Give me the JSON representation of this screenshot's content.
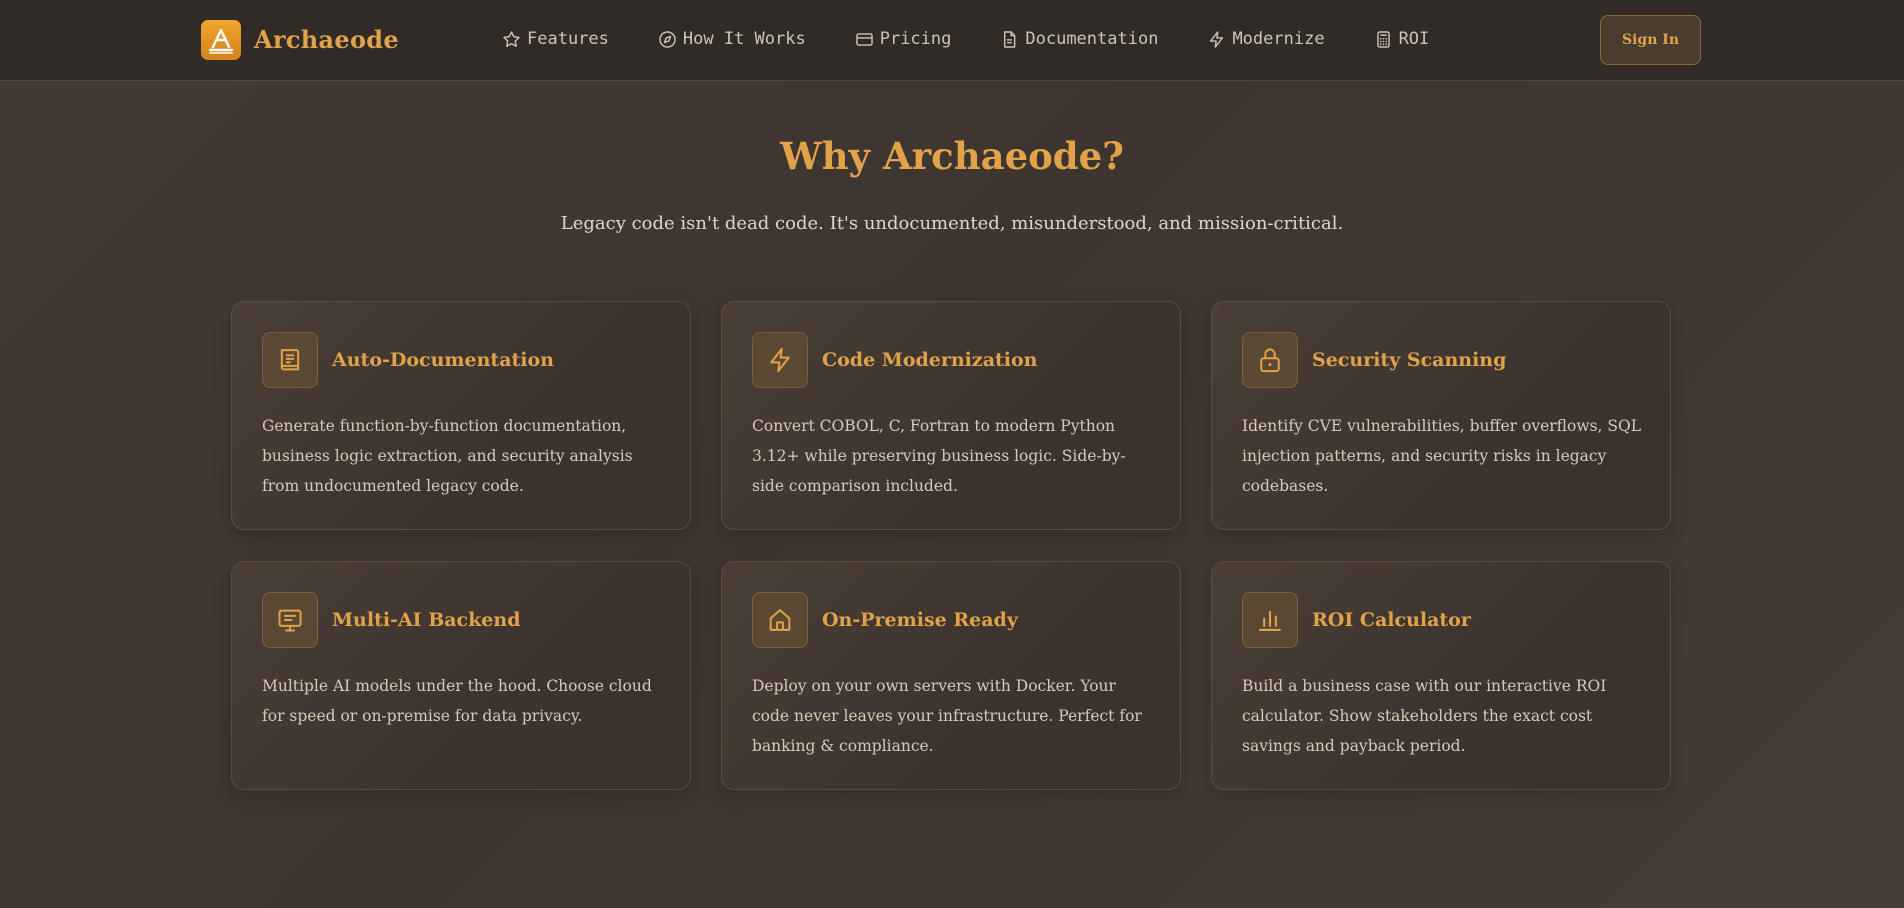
{
  "brand": {
    "name": "Archaeode",
    "logo_icon": "arch-logo-icon"
  },
  "nav": {
    "links": [
      {
        "label": "Features",
        "icon": "star-icon"
      },
      {
        "label": "How It Works",
        "icon": "compass-icon"
      },
      {
        "label": "Pricing",
        "icon": "credit-card-icon"
      },
      {
        "label": "Documentation",
        "icon": "document-icon"
      },
      {
        "label": "Modernize",
        "icon": "lightning-icon"
      },
      {
        "label": "ROI",
        "icon": "calculator-icon"
      }
    ],
    "signin_label": "Sign In"
  },
  "hero": {
    "title": "Why Archaeode?",
    "subtitle": "Legacy code isn't dead code. It's undocumented, misunderstood, and mission-critical."
  },
  "features": [
    {
      "title": "Auto-Documentation",
      "icon": "book-icon",
      "description": "Generate function-by-function documentation, business logic extraction, and security analysis from undocumented legacy code."
    },
    {
      "title": "Code Modernization",
      "icon": "lightning-icon",
      "description": "Convert COBOL, C, Fortran to modern Python 3.12+ while preserving business logic. Side-by-side comparison included."
    },
    {
      "title": "Security Scanning",
      "icon": "lock-icon",
      "description": "Identify CVE vulnerabilities, buffer overflows, SQL injection patterns, and security risks in legacy codebases."
    },
    {
      "title": "Multi-AI Backend",
      "icon": "monitor-icon",
      "description": "Multiple AI models under the hood. Choose cloud for speed or on-premise for data privacy."
    },
    {
      "title": "On-Premise Ready",
      "icon": "home-icon",
      "description": "Deploy on your own servers with Docker. Your code never leaves your infrastructure. Perfect for banking & compliance."
    },
    {
      "title": "ROI Calculator",
      "icon": "bar-chart-icon",
      "description": "Build a business case with our interactive ROI calculator. Show stakeholders the exact cost savings and payback period."
    }
  ],
  "colors": {
    "accent": "#e1a24a",
    "background": "#403731",
    "nav_background": "#312b27"
  }
}
